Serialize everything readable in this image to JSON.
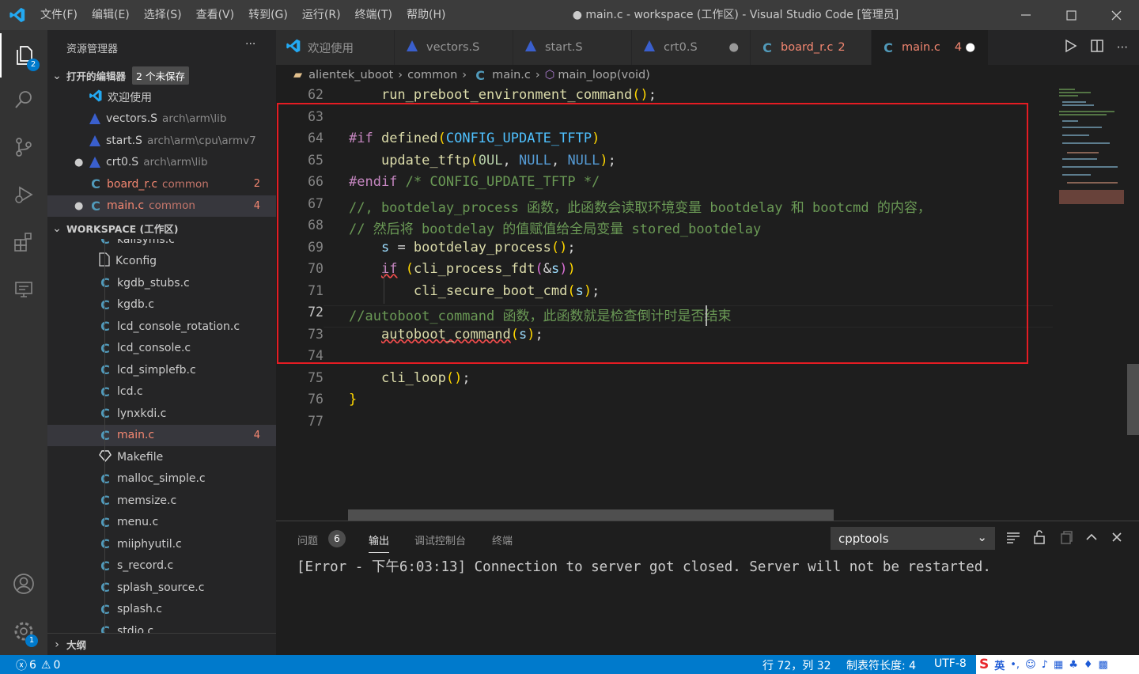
{
  "menu": [
    "文件(F)",
    "编辑(E)",
    "选择(S)",
    "查看(V)",
    "转到(G)",
    "运行(R)",
    "终端(T)",
    "帮助(H)"
  ],
  "window_title": "● main.c - workspace (工作区) - Visual Studio Code [管理员]",
  "activity_badges": {
    "explorer": "2",
    "settings": "1"
  },
  "sidebar": {
    "title": "资源管理器",
    "more": "···",
    "open_editors_header": "打开的编辑器",
    "unsaved_badge": "2 个未保存",
    "open_editors": [
      {
        "name": "欢迎使用",
        "path": "",
        "count": ""
      },
      {
        "name": "vectors.S",
        "path": "arch\\arm\\lib",
        "count": ""
      },
      {
        "name": "start.S",
        "path": "arch\\arm\\cpu\\armv7",
        "count": ""
      },
      {
        "name": "crt0.S",
        "path": "arch\\arm\\lib",
        "count": ""
      },
      {
        "name": "board_r.c",
        "path": "common",
        "count": "2"
      },
      {
        "name": "main.c",
        "path": "common",
        "count": "4"
      }
    ],
    "workspace_header": "WORKSPACE (工作区)",
    "files": [
      {
        "name": "kallsyms.c",
        "count": ""
      },
      {
        "name": "Kconfig",
        "count": ""
      },
      {
        "name": "kgdb_stubs.c",
        "count": ""
      },
      {
        "name": "kgdb.c",
        "count": ""
      },
      {
        "name": "lcd_console_rotation.c",
        "count": ""
      },
      {
        "name": "lcd_console.c",
        "count": ""
      },
      {
        "name": "lcd_simplefb.c",
        "count": ""
      },
      {
        "name": "lcd.c",
        "count": ""
      },
      {
        "name": "lynxkdi.c",
        "count": ""
      },
      {
        "name": "main.c",
        "count": "4"
      },
      {
        "name": "Makefile",
        "count": ""
      },
      {
        "name": "malloc_simple.c",
        "count": ""
      },
      {
        "name": "memsize.c",
        "count": ""
      },
      {
        "name": "menu.c",
        "count": ""
      },
      {
        "name": "miiphyutil.c",
        "count": ""
      },
      {
        "name": "s_record.c",
        "count": ""
      },
      {
        "name": "splash_source.c",
        "count": ""
      },
      {
        "name": "splash.c",
        "count": ""
      },
      {
        "name": "stdio.c",
        "count": ""
      }
    ],
    "outline_header": "大纲"
  },
  "tabs": [
    {
      "label": "欢迎使用",
      "count": ""
    },
    {
      "label": "vectors.S",
      "count": ""
    },
    {
      "label": "start.S",
      "count": ""
    },
    {
      "label": "crt0.S",
      "count": ""
    },
    {
      "label": "board_r.c",
      "count": "2"
    },
    {
      "label": "main.c",
      "count": "4"
    }
  ],
  "breadcrumb": [
    "alientek_uboot",
    "common",
    "main.c",
    "main_loop(void)"
  ],
  "code_lines": [
    {
      "n": "62",
      "parts": [
        [
          "    ",
          ""
        ],
        [
          "run_preboot_environment_command",
          "fn"
        ],
        [
          "(",
          "br"
        ],
        [
          ")",
          "br"
        ],
        [
          ";",
          ""
        ]
      ]
    },
    {
      "n": "63",
      "parts": []
    },
    {
      "n": "64",
      "parts": [
        [
          "#if ",
          "kw"
        ],
        [
          "defined",
          "fn"
        ],
        [
          "(",
          "br"
        ],
        [
          "CONFIG_UPDATE_TFTP",
          "mc"
        ],
        [
          ")",
          "br"
        ]
      ]
    },
    {
      "n": "65",
      "parts": [
        [
          "    ",
          ""
        ],
        [
          "update_tftp",
          "fn"
        ],
        [
          "(",
          "br"
        ],
        [
          "0UL",
          "nb"
        ],
        [
          ", ",
          ""
        ],
        [
          "NULL",
          "cst"
        ],
        [
          ", ",
          ""
        ],
        [
          "NULL",
          "cst"
        ],
        [
          ")",
          "br"
        ],
        [
          ";",
          ""
        ]
      ]
    },
    {
      "n": "66",
      "parts": [
        [
          "#endif ",
          "kw"
        ],
        [
          "/* CONFIG_UPDATE_TFTP */",
          "cm"
        ]
      ]
    },
    {
      "n": "67",
      "parts": [
        [
          "//, bootdelay_process 函数，此函数会读取环境变量 bootdelay 和 bootcmd 的内容，",
          "cm"
        ]
      ]
    },
    {
      "n": "68",
      "parts": [
        [
          "// 然后将 bootdelay 的值赋值给全局变量 stored_bootdelay",
          "cm"
        ]
      ]
    },
    {
      "n": "69",
      "parts": [
        [
          "    ",
          ""
        ],
        [
          "s",
          "vr"
        ],
        [
          " = ",
          ""
        ],
        [
          "bootdelay_process",
          "fn"
        ],
        [
          "(",
          "br"
        ],
        [
          ")",
          "br"
        ],
        [
          ";",
          ""
        ]
      ]
    },
    {
      "n": "70",
      "parts": [
        [
          "    ",
          ""
        ],
        [
          "if",
          "kw"
        ],
        [
          " ",
          ""
        ],
        [
          "(",
          "br"
        ],
        [
          "cli_process_fdt",
          "fn"
        ],
        [
          "(",
          "br2"
        ],
        [
          "&",
          "",
          ""
        ],
        [
          "s",
          "vr"
        ],
        [
          ")",
          "br2"
        ],
        [
          ")",
          "br"
        ]
      ]
    },
    {
      "n": "71",
      "parts": [
        [
          "        ",
          ""
        ],
        [
          "cli_secure_boot_cmd",
          "fn"
        ],
        [
          "(",
          "br"
        ],
        [
          "s",
          "vr"
        ],
        [
          ")",
          "br"
        ],
        [
          ";",
          ""
        ]
      ]
    },
    {
      "n": "72",
      "parts": [
        [
          "//autoboot_command 函数，此函数就是检查倒计时是否结束",
          "cm"
        ]
      ]
    },
    {
      "n": "73",
      "parts": [
        [
          "    ",
          ""
        ],
        [
          "autoboot_command",
          "fn"
        ],
        [
          "(",
          "br"
        ],
        [
          "s",
          "vr"
        ],
        [
          ")",
          "br"
        ],
        [
          ";",
          ""
        ]
      ]
    },
    {
      "n": "74",
      "parts": []
    },
    {
      "n": "75",
      "parts": [
        [
          "    ",
          ""
        ],
        [
          "cli_loop",
          "fn"
        ],
        [
          "(",
          "br"
        ],
        [
          ")",
          "br"
        ],
        [
          ";",
          ""
        ]
      ]
    },
    {
      "n": "76",
      "parts": [
        [
          "}",
          "br"
        ]
      ]
    },
    {
      "n": "77",
      "parts": []
    }
  ],
  "panel": {
    "tabs": [
      "问题",
      "输出",
      "调试控制台",
      "终端"
    ],
    "problems_count": "6",
    "dropdown": "cpptools",
    "output": "[Error - 下午6:03:13] Connection to server got closed. Server will not be restarted."
  },
  "status": {
    "errors": "6",
    "warnings": "0",
    "position": "行 72，列 32",
    "tab_size": "制表符长度: 4",
    "encoding": "UTF-8",
    "ime": "英"
  },
  "colors": {
    "accent": "#007acc",
    "highlight_box": "#e51c23",
    "modified": "#e2c08d",
    "error": "#f48771"
  }
}
